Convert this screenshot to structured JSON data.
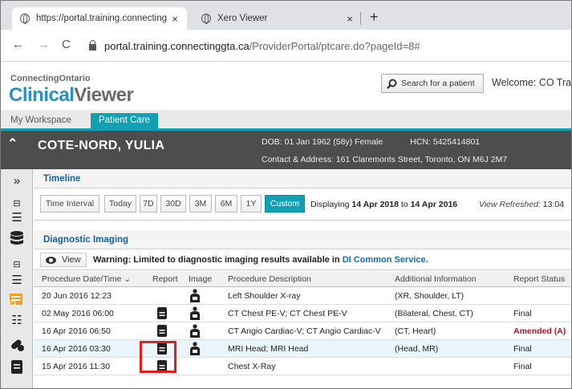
{
  "browser": {
    "active_tab": "https://portal.training.connecting",
    "inactive_tab": "Xero Viewer",
    "url_host": "portal.training.connectinggta.ca",
    "url_path": "/ProviderPortal/ptcare.do?pageId=8#"
  },
  "app": {
    "brand_top": "ConnectingOntario",
    "brand_clinical": "Clinical",
    "brand_viewer": "Viewer",
    "search_label": "Search for a patient",
    "welcome": "Welcome: CO Tra"
  },
  "workspace_tabs": [
    "My Workspace",
    "Patient Care"
  ],
  "patient": {
    "name": "COTE-NORD, YULIA",
    "dob": "DOB:  01 Jan 1962 (58y)  Female",
    "hcn": "HCN:  5425414801",
    "address": "Contact & Address:  161 Claremonts Street, Toronto, ON M6J 2M7"
  },
  "timeline": {
    "title": "Timeline",
    "interval_label": "Time Interval",
    "buttons": [
      "Today",
      "7D",
      "30D",
      "3M",
      "6M",
      "1Y",
      "Custom"
    ],
    "displaying_prefix": "Displaying",
    "from": "14 Apr 2018",
    "to_word": "to",
    "to": "14 Apr 2016",
    "refreshed_label": "View Refreshed:",
    "refreshed_time": "13:04"
  },
  "di": {
    "title": "Diagnostic Imaging",
    "view_label": "View",
    "warning": "Warning: Limited to diagnostic imaging results available in",
    "warning_link": "DI Common Service."
  },
  "table": {
    "headers": {
      "date": "Procedure Date/Time",
      "report": "Report",
      "image": "Image",
      "desc": "Procedure Description",
      "add": "Additional Information",
      "status": "Report Status"
    },
    "rows": [
      {
        "date": "20 Jun 2016 12:23",
        "desc": "Left Shoulder X-ray",
        "add": "(XR, Shoulder, LT)",
        "status": ""
      },
      {
        "date": "02 May 2016 06:00",
        "desc": "CT Chest PE-V; CT Chest PE-V",
        "add": "(Bilateral, Chest, CT)",
        "status": "Final"
      },
      {
        "date": "16 Apr 2016 06:50",
        "desc": "CT Angio Cardiac-V; CT Angio Cardiac-V",
        "add": "(CT, Heart)",
        "status": "Amended (A)"
      },
      {
        "date": "16 Apr 2016 03:30",
        "desc": "MRI Head; MRI Head",
        "add": "(Head, MR)",
        "status": "Final"
      },
      {
        "date": "15 Apr 2016 11:30",
        "desc": "Chest X-Ray",
        "add": "",
        "status": "Final"
      }
    ]
  },
  "colors": {
    "accent": "#12a0b5",
    "banner": "#4d4d4d",
    "amended": "#c0102a",
    "highlight": "#e02020"
  }
}
